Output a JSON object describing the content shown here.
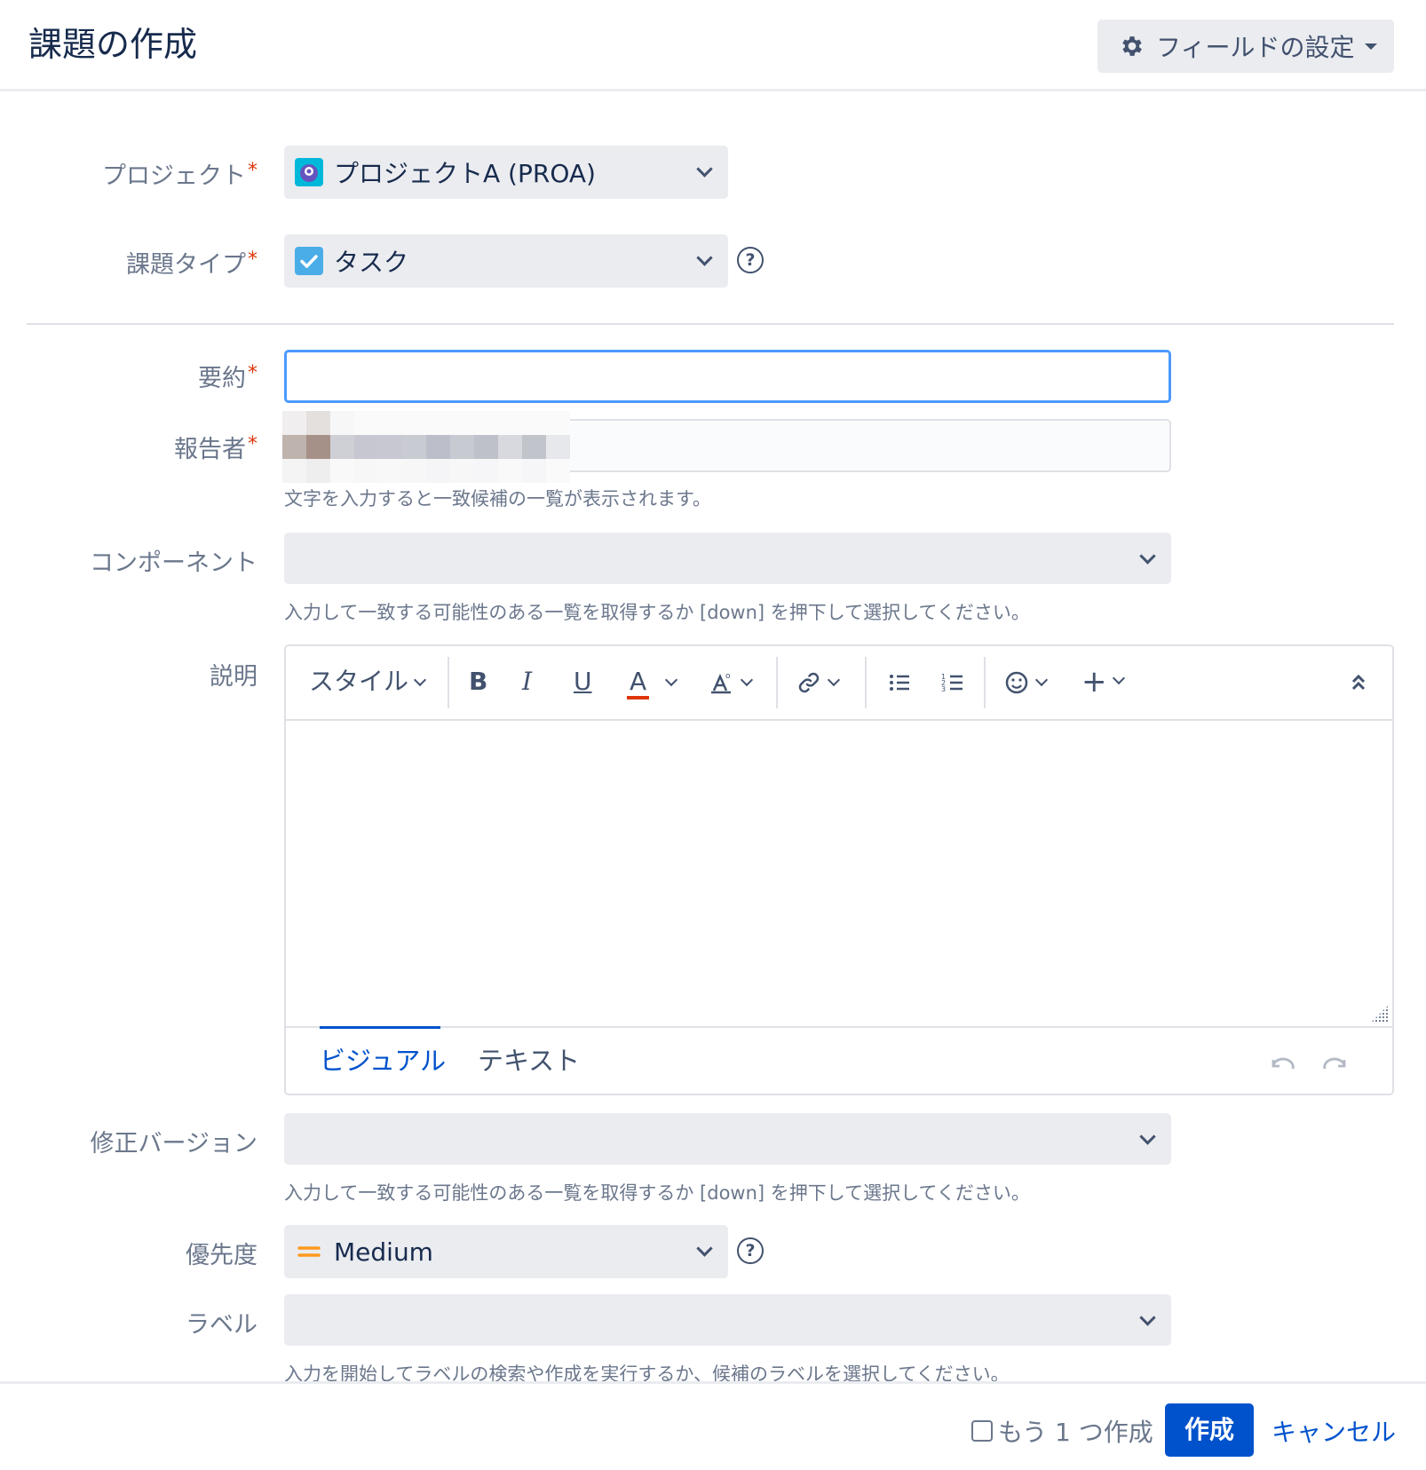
{
  "header": {
    "title": "課題の作成",
    "field_settings_label": "フィールドの設定"
  },
  "form": {
    "project": {
      "label": "プロジェクト",
      "value": "プロジェクトA (PROA)"
    },
    "issue_type": {
      "label": "課題タイプ",
      "value": "タスク"
    },
    "summary": {
      "label": "要約",
      "value": ""
    },
    "reporter": {
      "label": "報告者",
      "hint": "文字を入力すると一致候補の一覧が表示されます。"
    },
    "component": {
      "label": "コンポーネント",
      "value": "",
      "hint": "入力して一致する可能性のある一覧を取得するか [down] を押下して選択してください。"
    },
    "description": {
      "label": "説明",
      "toolbar": {
        "style_label": "スタイル"
      },
      "tabs": [
        "ビジュアル",
        "テキスト"
      ],
      "active_tab": "ビジュアル"
    },
    "fix_version": {
      "label": "修正バージョン",
      "value": "",
      "hint": "入力して一致する可能性のある一覧を取得するか [down] を押下して選択してください。"
    },
    "priority": {
      "label": "優先度",
      "value": "Medium"
    },
    "labels": {
      "label": "ラベル",
      "value": "",
      "hint": "入力を開始してラベルの検索や作成を実行するか、候補のラベルを選択してください。"
    },
    "required_mark": "*"
  },
  "footer": {
    "create_another_label": "もう 1 つ作成",
    "create_another_checked": false,
    "create_button": "作成",
    "cancel_link": "キャンセル"
  },
  "colors": {
    "primary": "#0052cc",
    "required": "#de350b",
    "priority_medium": "#ff991f",
    "task_icon": "#4bade8"
  }
}
